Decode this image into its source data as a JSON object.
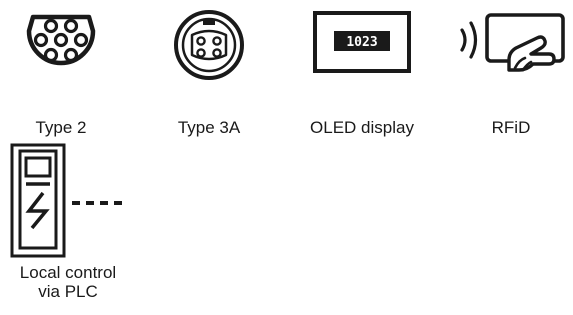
{
  "features": [
    {
      "id": "type2",
      "label": "Type 2",
      "icon": "type2-connector-icon"
    },
    {
      "id": "type3a",
      "label": "Type 3A",
      "icon": "type3a-connector-icon"
    },
    {
      "id": "oled",
      "label": "OLED display",
      "icon": "oled-display-icon",
      "display_value": "1023"
    },
    {
      "id": "rfid",
      "label": "RFiD",
      "icon": "rfid-card-icon"
    },
    {
      "id": "plc",
      "label_line1": "Local control",
      "label_line2": "via PLC",
      "icon": "charging-station-plc-icon"
    }
  ],
  "colors": {
    "icon": "#1a1a1a",
    "background": "#ffffff"
  }
}
